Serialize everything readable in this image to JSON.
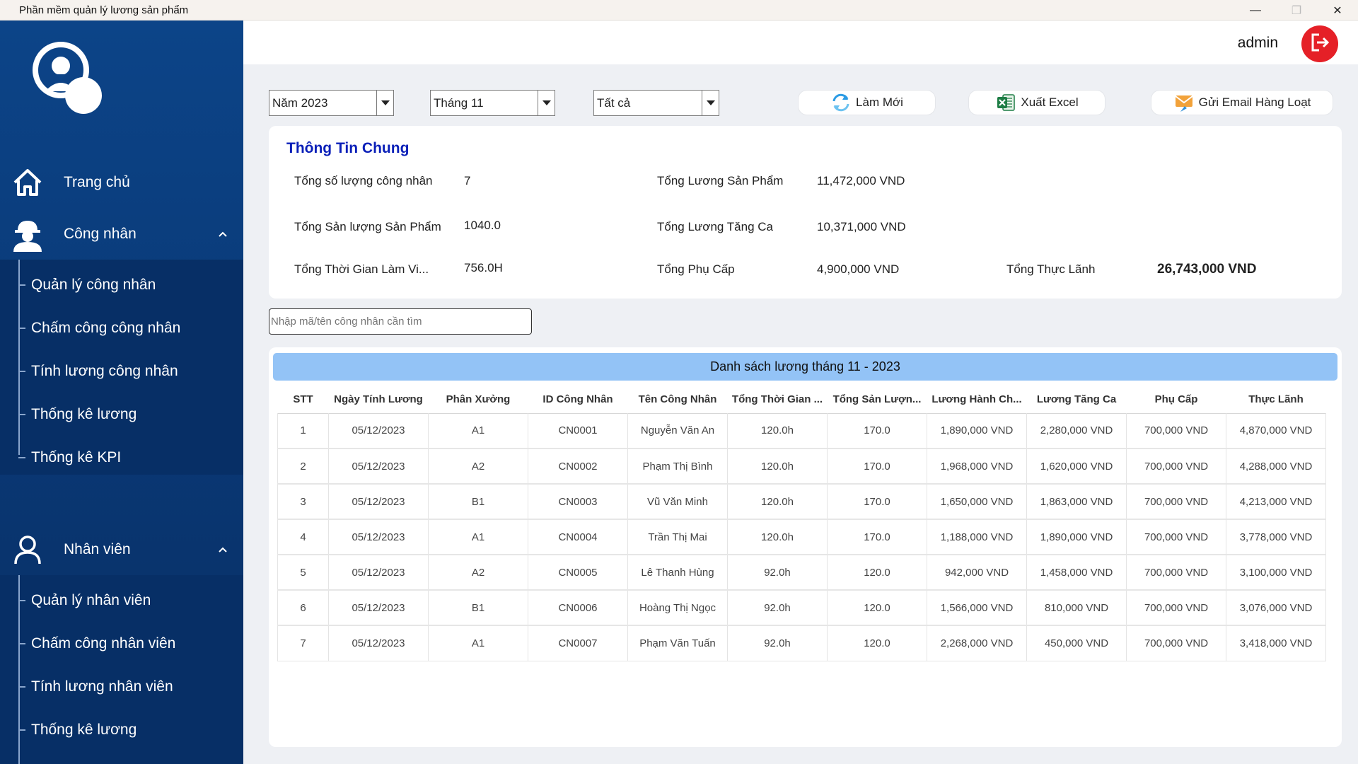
{
  "window": {
    "title": "Phần mềm quản lý lương sản phẩm",
    "minimize": "—",
    "maximize": "❐",
    "close": "✕"
  },
  "sidebar": {
    "home": "Trang chủ",
    "workers": {
      "label": "Công nhân",
      "items": [
        "Quản lý công nhân",
        "Chấm công công nhân",
        "Tính lương công nhân",
        "Thống kê lương",
        "Thống kê KPI"
      ]
    },
    "staff": {
      "label": "Nhân viên",
      "items": [
        "Quản lý nhân viên",
        "Chấm công nhân viên",
        "Tính lương nhân viên",
        "Thống kê lương"
      ]
    }
  },
  "header": {
    "user": "admin"
  },
  "filters": {
    "year": "Năm 2023",
    "month": "Tháng 11",
    "workshop": "Tất cả"
  },
  "actions": {
    "refresh": "Làm Mới",
    "export": "Xuất Excel",
    "email": "Gửi Email Hàng Loạt"
  },
  "summary": {
    "heading": "Thông Tin Chung",
    "total_workers_label": "Tổng số lượng công nhân",
    "total_workers": "7",
    "total_output_label": "Tổng Sản lượng Sản Phẩm",
    "total_output": "1040.0",
    "total_hours_label": "Tổng Thời Gian Làm Vi...",
    "total_hours": "756.0H",
    "product_salary_label": "Tổng Lương Sản Phẩm",
    "product_salary": "11,472,000 VND",
    "overtime_salary_label": "Tổng Lương Tăng Ca",
    "overtime_salary": "10,371,000 VND",
    "allowance_label": "Tổng Phụ Cấp",
    "allowance": "4,900,000 VND",
    "net_label": "Tổng Thực Lãnh",
    "net": "26,743,000 VND"
  },
  "search": {
    "placeholder": "Nhập mã/tên công nhân cần tìm"
  },
  "table": {
    "banner": "Danh sách lương tháng 11 - 2023",
    "columns": [
      "STT",
      "Ngày Tính Lương",
      "Phân Xưởng",
      "ID Công Nhân",
      "Tên Công Nhân",
      "Tổng Thời Gian ...",
      "Tổng Sản Lượn...",
      "Lương Hành Ch...",
      "Lương Tăng Ca",
      "Phụ Cấp",
      "Thực Lãnh"
    ],
    "rows": [
      [
        "1",
        "05/12/2023",
        "A1",
        "CN0001",
        "Nguyễn Văn An",
        "120.0h",
        "170.0",
        "1,890,000 VND",
        "2,280,000 VND",
        "700,000 VND",
        "4,870,000 VND"
      ],
      [
        "2",
        "05/12/2023",
        "A2",
        "CN0002",
        "Phạm Thị Bình",
        "120.0h",
        "170.0",
        "1,968,000 VND",
        "1,620,000 VND",
        "700,000 VND",
        "4,288,000 VND"
      ],
      [
        "3",
        "05/12/2023",
        "B1",
        "CN0003",
        "Vũ Văn Minh",
        "120.0h",
        "170.0",
        "1,650,000 VND",
        "1,863,000 VND",
        "700,000 VND",
        "4,213,000 VND"
      ],
      [
        "4",
        "05/12/2023",
        "A1",
        "CN0004",
        "Trần Thị Mai",
        "120.0h",
        "170.0",
        "1,188,000 VND",
        "1,890,000 VND",
        "700,000 VND",
        "3,778,000 VND"
      ],
      [
        "5",
        "05/12/2023",
        "A2",
        "CN0005",
        "Lê Thanh Hùng",
        "92.0h",
        "120.0",
        "942,000 VND",
        "1,458,000 VND",
        "700,000 VND",
        "3,100,000 VND"
      ],
      [
        "6",
        "05/12/2023",
        "B1",
        "CN0006",
        "Hoàng Thị Ngọc",
        "92.0h",
        "120.0",
        "1,566,000 VND",
        "810,000 VND",
        "700,000 VND",
        "3,076,000 VND"
      ],
      [
        "7",
        "05/12/2023",
        "A1",
        "CN0007",
        "Phạm Văn Tuấn",
        "92.0h",
        "120.0",
        "2,268,000 VND",
        "450,000 VND",
        "700,000 VND",
        "3,418,000 VND"
      ]
    ]
  }
}
